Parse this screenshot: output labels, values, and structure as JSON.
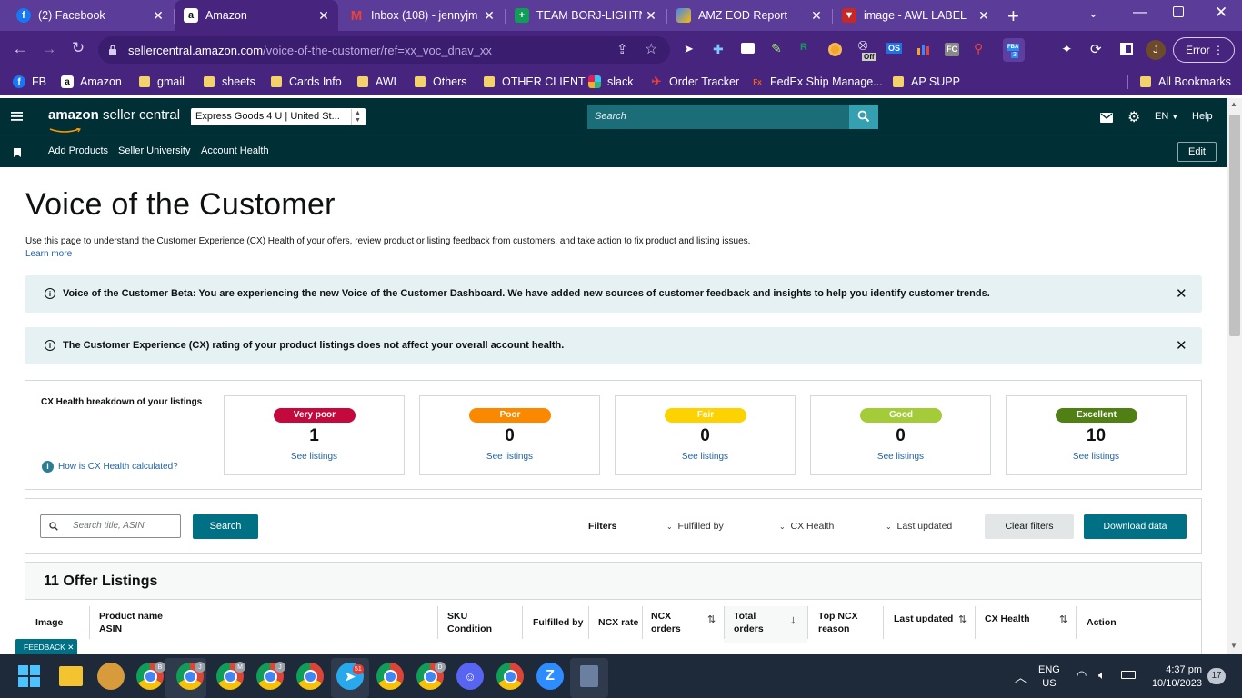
{
  "browser": {
    "tabs": [
      {
        "title": "(2) Facebook",
        "icon": "facebook-icon"
      },
      {
        "title": "Amazon",
        "icon": "amazon-icon"
      },
      {
        "title": "Inbox (108) - jennyjm",
        "icon": "gmail-icon"
      },
      {
        "title": "TEAM BORJ-LIGHTNI",
        "icon": "sheets-icon"
      },
      {
        "title": "AMZ EOD Report",
        "icon": "report-icon"
      },
      {
        "title": "image - AWL LABEL",
        "icon": "awl-icon"
      }
    ],
    "new_tab": "+",
    "url_host": "sellercentral.amazon.com",
    "url_path": "/voice-of-the-customer/ref=xx_voc_dnav_xx",
    "profile_initial": "J",
    "error_label": "Error",
    "ext_badge": "3",
    "ext_off": "Off",
    "ext_os": "OS",
    "ext_fc": "FC",
    "ext_fba": "FBA",
    "bookmarks": [
      "FB",
      "Amazon",
      "gmail",
      "sheets",
      "Cards Info",
      "AWL",
      "Others",
      "OTHER CLIENT",
      "slack",
      "Order Tracker",
      "FedEx Ship Manage...",
      "AP SUPP"
    ],
    "all_bookmarks": "All Bookmarks"
  },
  "seller": {
    "logo_a": "amazon",
    "logo_b": " seller central",
    "store_select": "Express Goods 4 U | United St...",
    "search_placeholder": "Search",
    "lang": "EN",
    "help": "Help",
    "nav": [
      "Add Products",
      "Seller University",
      "Account Health"
    ],
    "edit": "Edit"
  },
  "page": {
    "title": "Voice of the Customer",
    "description": "Use this page to understand the Customer Experience (CX) Health of your offers, review product or listing feedback from customers, and take action to fix product and listing issues.",
    "learn_more": "Learn more",
    "banner1": "Voice of the Customer Beta: You are experiencing the new Voice of the Customer Dashboard. We have added new sources of customer feedback and insights to help you identify customer trends.",
    "banner2": "The Customer Experience (CX) rating of your product listings does not affect your overall account health.",
    "breakdown_title": "CX Health breakdown of your listings",
    "how_calc": "How is CX Health calculated?",
    "cards": [
      {
        "label": "Very poor",
        "count": "1",
        "link": "See listings",
        "color": "#c40a3d"
      },
      {
        "label": "Poor",
        "count": "0",
        "link": "See listings",
        "color": "#fa8900"
      },
      {
        "label": "Fair",
        "count": "0",
        "link": "See listings",
        "color": "#fcd200"
      },
      {
        "label": "Good",
        "count": "0",
        "link": "See listings",
        "color": "#a4cb38"
      },
      {
        "label": "Excellent",
        "count": "10",
        "link": "See listings",
        "color": "#507f13"
      }
    ],
    "search_ph": "Search title, ASIN",
    "search_btn": "Search",
    "filters_label": "Filters",
    "filter_fulfilled": "Fulfilled by",
    "filter_cx": "CX Health",
    "filter_updated": "Last updated",
    "clear_filters": "Clear filters",
    "download": "Download data",
    "listings_title": "11 Offer Listings",
    "columns": {
      "image": "Image",
      "product_name": "Product name",
      "asin": "ASIN",
      "sku": "SKU",
      "condition": "Condition",
      "fulfilled_by": "Fulfilled by",
      "ncx_rate": "NCX rate",
      "ncx": "NCX",
      "orders": "orders",
      "total": "Total",
      "top_ncx": "Top NCX",
      "reason": "reason",
      "last_updated": "Last updated",
      "cx_health": "CX Health",
      "action": "Action"
    },
    "feedback": "FEEDBACK"
  },
  "taskbar": {
    "telegram_badge": "51",
    "lang_top": "ENG",
    "lang_bottom": "US",
    "time": "4:37 pm",
    "date": "10/10/2023",
    "notif": "17",
    "profile_badges": [
      "B",
      "J",
      "M",
      "J",
      "D"
    ]
  },
  "colors": {
    "chrome_dark": "#47257f",
    "chrome_tabs": "#5b3c99",
    "seller_header": "#002f36",
    "accent": "#007185",
    "banner_bg": "#e5f1f2"
  }
}
